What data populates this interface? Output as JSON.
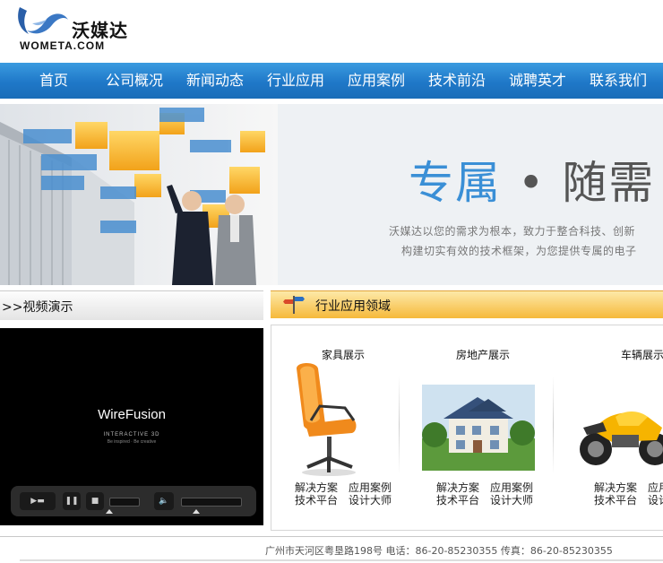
{
  "brand": {
    "name_cn": "沃媒达",
    "name_en": "WOMETA.COM"
  },
  "nav": {
    "items": [
      {
        "label": "首页"
      },
      {
        "label": "公司概况"
      },
      {
        "label": "新闻动态"
      },
      {
        "label": "行业应用"
      },
      {
        "label": "应用案例"
      },
      {
        "label": "技术前沿"
      },
      {
        "label": "诚聘英才"
      },
      {
        "label": "联系我们"
      }
    ]
  },
  "banner": {
    "slogan_accent": "专属",
    "slogan_dot": "•",
    "slogan_rest": "随需",
    "line1": "沃媒达以您的需求为根本，致力于整合科技、创新",
    "line2": "构建切实有效的技术框架，为您提供专属的电子"
  },
  "video": {
    "section_title": ">>视频演示",
    "player_title": "WireFusion",
    "player_subtitle": "INTERACTIVE 3D",
    "player_subtitle2": "Be inspired · Be creative"
  },
  "industry": {
    "section_title": "行业应用领域",
    "categories": [
      {
        "label": "家具展示",
        "link1": "解决方案",
        "link2": "应用案例",
        "link3": "技术平台",
        "link4": "设计大师"
      },
      {
        "label": "房地产展示",
        "link1": "解决方案",
        "link2": "应用案例",
        "link3": "技术平台",
        "link4": "设计大师"
      },
      {
        "label": "车辆展示",
        "link1": "解决方案",
        "link2": "应用",
        "link3": "技术平台",
        "link4": "设计"
      }
    ]
  },
  "footer": {
    "text": "广州市天河区粤垦路198号 电话：86-20-85230355 传真：86-20-85230355"
  },
  "colors": {
    "nav_blue": "#1f78c8",
    "accent_orange": "#f6b93a",
    "slogan_blue": "#3a8fd6"
  }
}
